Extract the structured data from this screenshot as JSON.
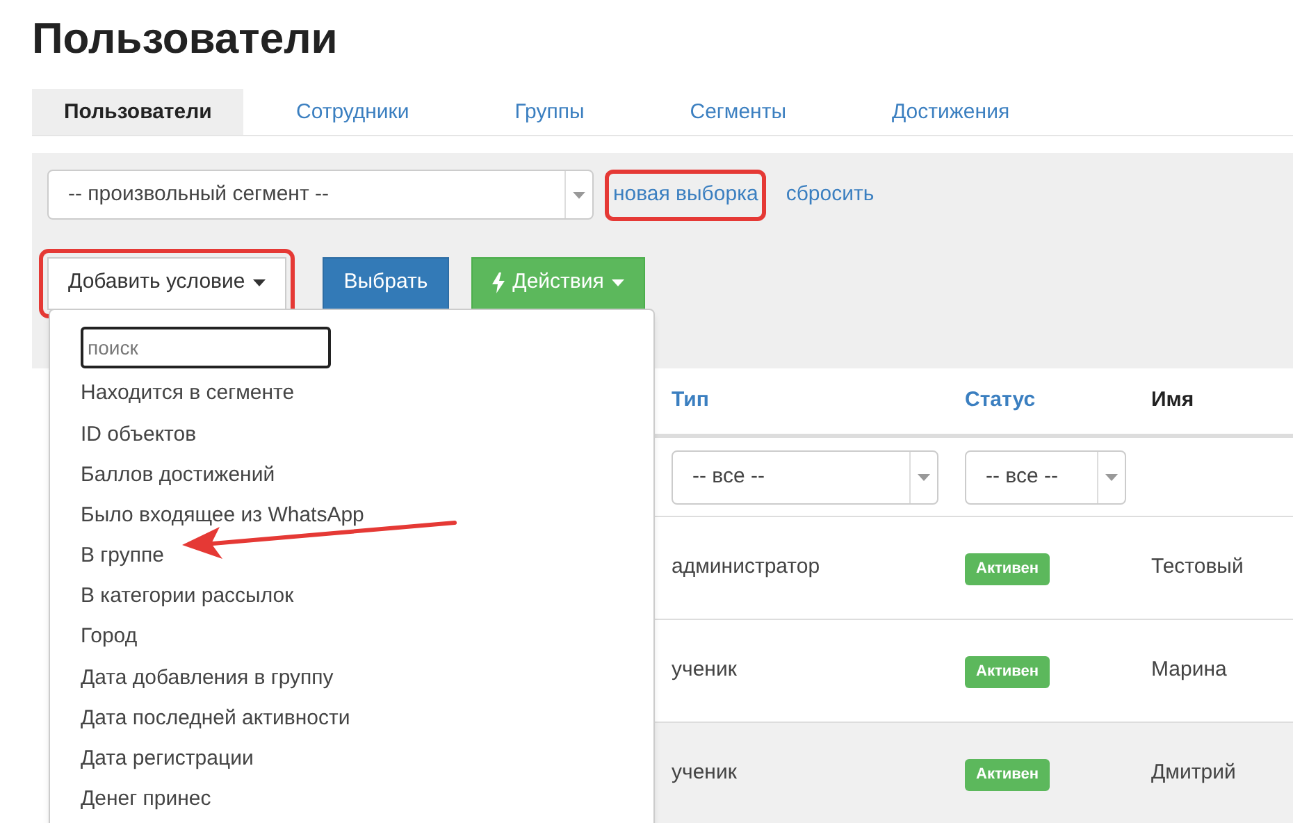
{
  "page_title": "Пользователи",
  "tabs": [
    {
      "label": "Пользователи",
      "selected": true
    },
    {
      "label": "Сотрудники",
      "selected": false
    },
    {
      "label": "Группы",
      "selected": false
    },
    {
      "label": "Сегменты",
      "selected": false
    },
    {
      "label": "Достижения",
      "selected": false
    }
  ],
  "segment_select": {
    "value": "-- произвольный сегмент --"
  },
  "links": [
    {
      "label": "новая выборка",
      "highlighted": true
    },
    {
      "label": "сбросить",
      "highlighted": false
    }
  ],
  "buttons": [
    {
      "kind": "dropdown",
      "label": "Добавить условие",
      "highlighted": true
    },
    {
      "kind": "primary",
      "label": "Выбрать",
      "highlighted": false
    },
    {
      "kind": "actions",
      "label": "Действия",
      "highlighted": false
    }
  ],
  "condition_menu": {
    "search_placeholder": "поиск",
    "items": [
      {
        "label": "Находится в сегменте",
        "pointed": false
      },
      {
        "label": "ID объектов",
        "pointed": false
      },
      {
        "label": "Баллов достижений",
        "pointed": false
      },
      {
        "label": "Было входящее из WhatsApp",
        "pointed": false
      },
      {
        "label": "В группе",
        "pointed": true
      },
      {
        "label": "В категории рассылок",
        "pointed": false
      },
      {
        "label": "Город",
        "pointed": false
      },
      {
        "label": "Дата добавления в группу",
        "pointed": false
      },
      {
        "label": "Дата последней активности",
        "pointed": false
      },
      {
        "label": "Дата регистрации",
        "pointed": false
      },
      {
        "label": "Денег принес",
        "pointed": false
      }
    ]
  },
  "table": {
    "columns": [
      {
        "label": "Тип",
        "sortable": true
      },
      {
        "label": "Статус",
        "sortable": true
      },
      {
        "label": "Имя",
        "sortable": false
      }
    ],
    "filters": [
      "-- все --",
      "-- все --"
    ],
    "rows": [
      {
        "type": "администратор",
        "status": "Активен",
        "name": "Тестовый",
        "selected": false
      },
      {
        "type": "ученик",
        "status": "Активен",
        "name": "Марина",
        "selected": false
      },
      {
        "type": "ученик",
        "status": "Активен",
        "name": "Дмитрий",
        "selected": true
      }
    ]
  }
}
